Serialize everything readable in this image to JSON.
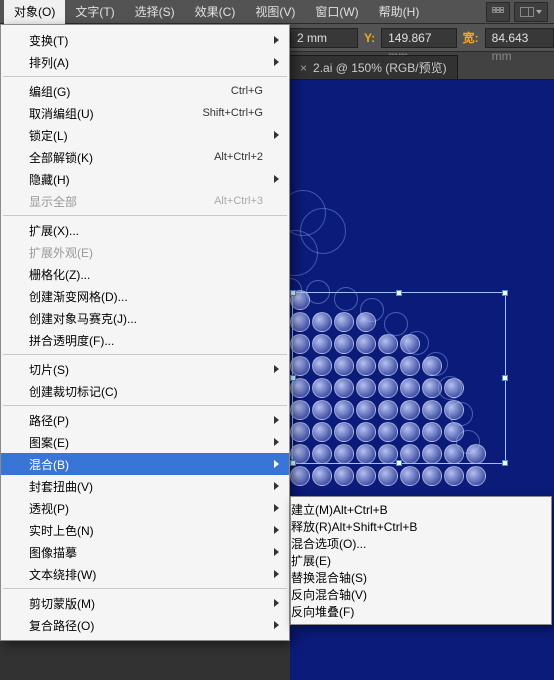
{
  "menubar": {
    "items": [
      "对象(O)",
      "文字(T)",
      "选择(S)",
      "效果(C)",
      "视图(V)",
      "窗口(W)",
      "帮助(H)"
    ]
  },
  "optbar": {
    "x_suffix": "2 mm",
    "y_label": "Y:",
    "y_value": "149.867",
    "w_label": "宽:",
    "w_value": "84.643",
    "unit": "mm"
  },
  "tab": {
    "title": "2.ai @ 150% (RGB/预览)",
    "close": "×"
  },
  "menu": [
    {
      "t": "sub",
      "l": "变换(T)"
    },
    {
      "t": "sub",
      "l": "排列(A)"
    },
    {
      "t": "sep"
    },
    {
      "t": "i",
      "l": "编组(G)",
      "s": "Ctrl+G"
    },
    {
      "t": "i",
      "l": "取消编组(U)",
      "s": "Shift+Ctrl+G"
    },
    {
      "t": "sub",
      "l": "锁定(L)"
    },
    {
      "t": "i",
      "l": "全部解锁(K)",
      "s": "Alt+Ctrl+2"
    },
    {
      "t": "sub",
      "l": "隐藏(H)"
    },
    {
      "t": "d",
      "l": "显示全部",
      "s": "Alt+Ctrl+3"
    },
    {
      "t": "sep"
    },
    {
      "t": "i",
      "l": "扩展(X)..."
    },
    {
      "t": "d",
      "l": "扩展外观(E)"
    },
    {
      "t": "i",
      "l": "栅格化(Z)..."
    },
    {
      "t": "i",
      "l": "创建渐变网格(D)..."
    },
    {
      "t": "i",
      "l": "创建对象马赛克(J)..."
    },
    {
      "t": "i",
      "l": "拼合透明度(F)..."
    },
    {
      "t": "sep"
    },
    {
      "t": "sub",
      "l": "切片(S)"
    },
    {
      "t": "i",
      "l": "创建裁切标记(C)"
    },
    {
      "t": "sep"
    },
    {
      "t": "sub",
      "l": "路径(P)"
    },
    {
      "t": "sub",
      "l": "图案(E)"
    },
    {
      "t": "sub",
      "l": "混合(B)",
      "hi": true
    },
    {
      "t": "sub",
      "l": "封套扭曲(V)"
    },
    {
      "t": "sub",
      "l": "透视(P)"
    },
    {
      "t": "sub",
      "l": "实时上色(N)"
    },
    {
      "t": "sub",
      "l": "图像描摹"
    },
    {
      "t": "sub",
      "l": "文本绕排(W)"
    },
    {
      "t": "sep"
    },
    {
      "t": "sub",
      "l": "剪切蒙版(M)"
    },
    {
      "t": "sub",
      "l": "复合路径(O)"
    }
  ],
  "submenu": [
    {
      "t": "i",
      "l": "建立(M)",
      "s": "Alt+Ctrl+B"
    },
    {
      "t": "i",
      "l": "释放(R)",
      "s": "Alt+Shift+Ctrl+B"
    },
    {
      "t": "sep"
    },
    {
      "t": "i",
      "l": "混合选项(O)..."
    },
    {
      "t": "sep"
    },
    {
      "t": "i",
      "l": "扩展(E)",
      "hi": true
    },
    {
      "t": "sep"
    },
    {
      "t": "d",
      "l": "替换混合轴(S)"
    },
    {
      "t": "i",
      "l": "反向混合轴(V)"
    },
    {
      "t": "i",
      "l": "反向堆叠(F)"
    }
  ]
}
